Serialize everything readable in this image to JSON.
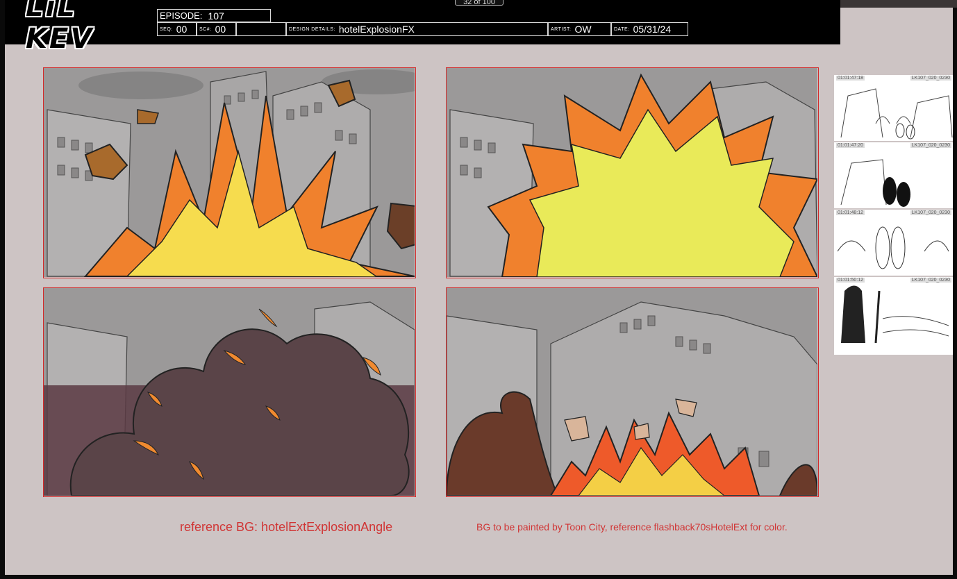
{
  "header": {
    "logo_text": "LiL KEV",
    "episode_label": "EPISODE:",
    "episode_value": "107",
    "seq_label": "SEQ:",
    "seq_value": "00",
    "sc_label": "SC#:",
    "sc_value": "00",
    "design_label": "DESIGN DETAILS:",
    "design_value": "hotelExplosionFX",
    "artist_label": "ARTIST:",
    "artist_value": "OW",
    "date_label": "DATE:",
    "date_value": "05/31/24",
    "page_counter": "32 of 100"
  },
  "panels": [
    {
      "label": "explosion-frame-1"
    },
    {
      "label": "explosion-frame-2"
    },
    {
      "label": "smoke-frame-3"
    },
    {
      "label": "fire-frame-4"
    }
  ],
  "captions": {
    "reference_bg": "reference BG: hotelExtExplosionAngle",
    "bg_note": "BG to be painted by Toon City, reference flashback70sHotelExt for color."
  },
  "thumbnails": [
    {
      "tc_left": "01:01:47:18",
      "tc_right": "LK107_020_0230"
    },
    {
      "tc_left": "01:01:47:20",
      "tc_right": "LK107_020_0230"
    },
    {
      "tc_left": "01:01:48:12",
      "tc_right": "LK107_020_0230"
    },
    {
      "tc_left": "01:01:50:12",
      "tc_right": "LK107_020_0230"
    }
  ],
  "colors": {
    "header_bg": "#000000",
    "panel_border": "#d22a2a",
    "caption_text": "#d03535",
    "page_bg": "#cdc4c4"
  }
}
